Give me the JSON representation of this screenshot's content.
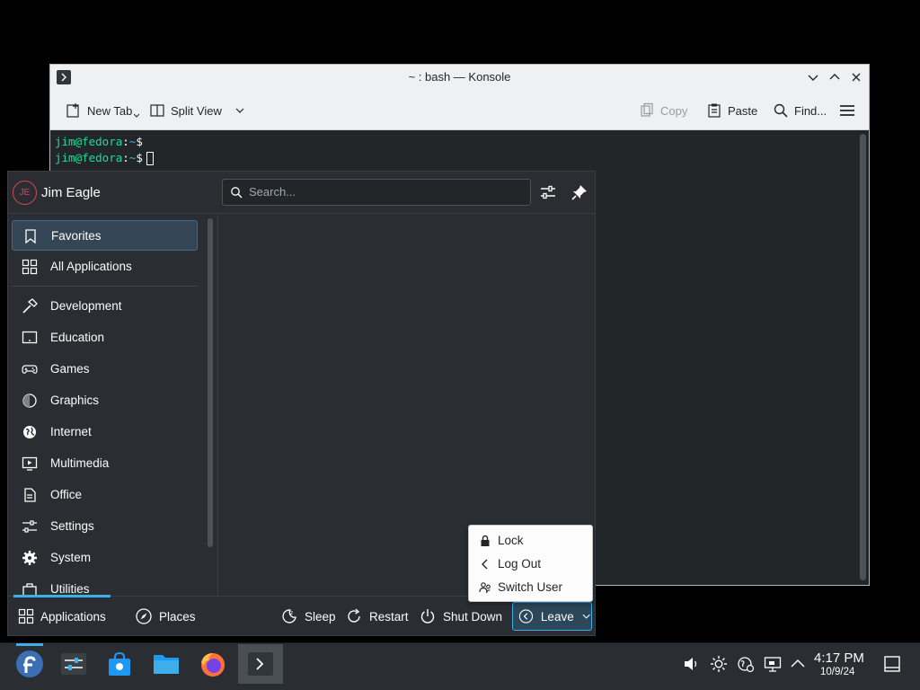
{
  "konsole": {
    "title": "~ : bash — Konsole",
    "toolbar": {
      "new_tab": "New Tab",
      "split_view": "Split View",
      "copy": "Copy",
      "paste": "Paste",
      "find": "Find..."
    },
    "terminal": {
      "lines": [
        {
          "user": "jim@fedora",
          "sep": ":",
          "path": "~",
          "prompt": "$"
        },
        {
          "user": "jim@fedora",
          "sep": ":",
          "path": "~",
          "prompt": "$"
        }
      ]
    }
  },
  "launcher": {
    "user": {
      "initials": "JE",
      "name": "Jim Eagle"
    },
    "search": {
      "placeholder": "Search..."
    },
    "categories": [
      {
        "label": "Favorites",
        "icon": "bookmark-icon",
        "selected": true
      },
      {
        "label": "All Applications",
        "icon": "grid-icon"
      },
      {
        "label": "Development",
        "icon": "hammer-icon"
      },
      {
        "label": "Education",
        "icon": "monitor-icon"
      },
      {
        "label": "Games",
        "icon": "gamepad-icon"
      },
      {
        "label": "Graphics",
        "icon": "graphics-icon"
      },
      {
        "label": "Internet",
        "icon": "globe-icon"
      },
      {
        "label": "Multimedia",
        "icon": "play-icon"
      },
      {
        "label": "Office",
        "icon": "document-icon"
      },
      {
        "label": "Settings",
        "icon": "sliders-icon"
      },
      {
        "label": "System",
        "icon": "gear-icon"
      },
      {
        "label": "Utilities",
        "icon": "toolbox-icon"
      }
    ],
    "footer": {
      "applications": "Applications",
      "places": "Places",
      "sleep": "Sleep",
      "restart": "Restart",
      "shutdown": "Shut Down",
      "leave": "Leave"
    },
    "leave_menu": [
      "Lock",
      "Log Out",
      "Switch User"
    ]
  },
  "taskbar": {
    "apps": [
      "fedora-launcher-icon",
      "system-settings-icon",
      "discover-icon",
      "dolphin-icon",
      "firefox-icon",
      "konsole-icon"
    ],
    "clock": {
      "time": "4:17 PM",
      "date": "10/9/24"
    }
  },
  "colors": {
    "accent": "#3daee9",
    "surface": "#2a2e32",
    "terminal_bg": "#232629",
    "prompt_user": "#1cdc9a"
  }
}
